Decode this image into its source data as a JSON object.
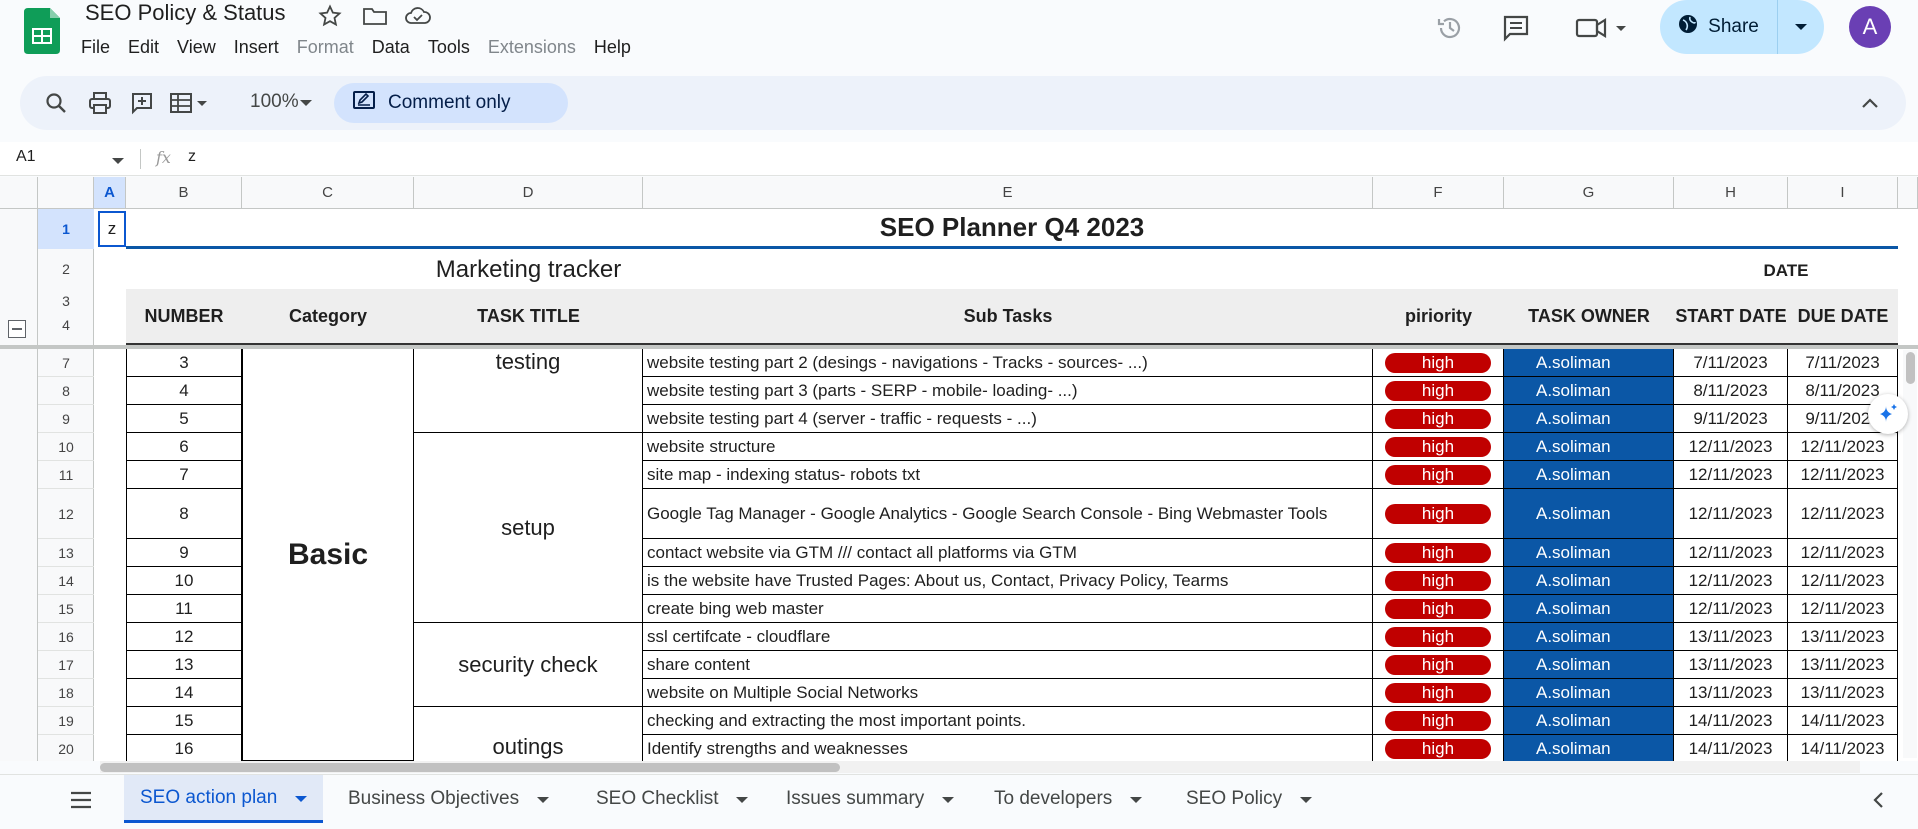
{
  "app": {
    "title": "SEO Policy & Status",
    "menu": [
      {
        "label": "File",
        "disabled": false
      },
      {
        "label": "Edit",
        "disabled": false
      },
      {
        "label": "View",
        "disabled": false
      },
      {
        "label": "Insert",
        "disabled": false
      },
      {
        "label": "Format",
        "disabled": true
      },
      {
        "label": "Data",
        "disabled": false
      },
      {
        "label": "Tools",
        "disabled": false
      },
      {
        "label": "Extensions",
        "disabled": true
      },
      {
        "label": "Help",
        "disabled": false
      }
    ],
    "share_label": "Share",
    "avatar_letter": "A",
    "brand_color": "#0f9d58"
  },
  "toolbar": {
    "zoom": "100%",
    "mode_label": "Comment only"
  },
  "formula": {
    "cell_ref": "A1",
    "fx": "fx",
    "value": "z"
  },
  "columns": [
    "A",
    "B",
    "C",
    "D",
    "E",
    "F",
    "G",
    "H",
    "I"
  ],
  "sheet": {
    "a1": "z",
    "title": "SEO Planner Q4 2023",
    "subtitle": "Marketing tracker",
    "date_group": "DATE",
    "headers": {
      "number": "NUMBER",
      "category": "Category",
      "task_title": "TASK TITLE",
      "sub_tasks": "Sub Tasks",
      "priority": "piriority",
      "owner": "TASK OWNER",
      "start": "START DATE",
      "due": "DUE DATE"
    },
    "header_row_nums": [
      "1",
      "2",
      "3",
      "4"
    ],
    "category_label": "Basic",
    "groups": [
      {
        "title": "testing"
      },
      {
        "title": "setup"
      },
      {
        "title": "security check"
      },
      {
        "title": "outings"
      }
    ],
    "rows": [
      {
        "row": "7",
        "num": "3",
        "sub": "website testing part 2 (desings - navigations - Tracks - sources- ...)",
        "prio": "high",
        "owner": "A.soliman",
        "start": "7/11/2023",
        "due": "7/11/2023"
      },
      {
        "row": "8",
        "num": "4",
        "sub": "website testing part 3 (parts - SERP - mobile- loading- ...)",
        "prio": "high",
        "owner": "A.soliman",
        "start": "8/11/2023",
        "due": "8/11/2023"
      },
      {
        "row": "9",
        "num": "5",
        "sub": "website testing part 4 (server - traffic - requests - ...)",
        "prio": "high",
        "owner": "A.soliman",
        "start": "9/11/2023",
        "due": "9/11/2023"
      },
      {
        "row": "10",
        "num": "6",
        "sub": "website structure",
        "prio": "high",
        "owner": "A.soliman",
        "start": "12/11/2023",
        "due": "12/11/2023"
      },
      {
        "row": "11",
        "num": "7",
        "sub": "site map - indexing status- robots txt",
        "prio": "high",
        "owner": "A.soliman",
        "start": "12/11/2023",
        "due": "12/11/2023"
      },
      {
        "row": "12",
        "num": "8",
        "sub": "Google Tag Manager - Google Analytics - Google Search Console - Bing Webmaster Tools",
        "prio": "high",
        "owner": "A.soliman",
        "start": "12/11/2023",
        "due": "12/11/2023"
      },
      {
        "row": "13",
        "num": "9",
        "sub": "contact website via GTM /// contact all platforms via GTM",
        "prio": "high",
        "owner": "A.soliman",
        "start": "12/11/2023",
        "due": "12/11/2023"
      },
      {
        "row": "14",
        "num": "10",
        "sub": "is the website have Trusted Pages: About us, Contact, Privacy Policy, Tearms",
        "prio": "high",
        "owner": "A.soliman",
        "start": "12/11/2023",
        "due": "12/11/2023"
      },
      {
        "row": "15",
        "num": "11",
        "sub": "create bing web master",
        "prio": "high",
        "owner": "A.soliman",
        "start": "12/11/2023",
        "due": "12/11/2023"
      },
      {
        "row": "16",
        "num": "12",
        "sub": "ssl certifcate - cloudflare",
        "prio": "high",
        "owner": "A.soliman",
        "start": "13/11/2023",
        "due": "13/11/2023"
      },
      {
        "row": "17",
        "num": "13",
        "sub": "share content",
        "prio": "high",
        "owner": "A.soliman",
        "start": "13/11/2023",
        "due": "13/11/2023"
      },
      {
        "row": "18",
        "num": "14",
        "sub": "website on Multiple Social Networks",
        "prio": "high",
        "owner": "A.soliman",
        "start": "13/11/2023",
        "due": "13/11/2023"
      },
      {
        "row": "19",
        "num": "15",
        "sub": "checking and extracting the most important points.",
        "prio": "high",
        "owner": "A.soliman",
        "start": "14/11/2023",
        "due": "14/11/2023"
      },
      {
        "row": "20",
        "num": "16",
        "sub": "Identify strengths and weaknesses",
        "prio": "high",
        "owner": "A.soliman",
        "start": "14/11/2023",
        "due": "14/11/2023"
      }
    ],
    "priority_color": "#c00000",
    "owner_color": "#0b57a6"
  },
  "tabs": [
    {
      "label": "SEO action plan",
      "active": true
    },
    {
      "label": "Business Objectives",
      "active": false
    },
    {
      "label": "SEO Checklist",
      "active": false
    },
    {
      "label": "Issues summary",
      "active": false
    },
    {
      "label": "To developers",
      "active": false
    },
    {
      "label": "SEO Policy",
      "active": false
    }
  ]
}
